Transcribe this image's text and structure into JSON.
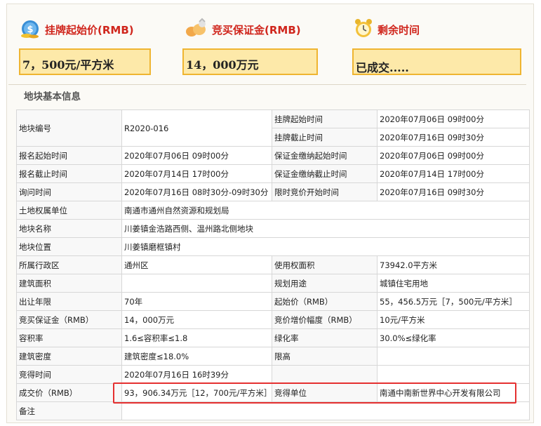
{
  "headers": {
    "start_price": "挂牌起始价(RMB)",
    "deposit": "竞买保证金(RMB)",
    "remaining_time": "剩余时间"
  },
  "values": {
    "start_price": "7，500元/平方米",
    "deposit": "14，000万元",
    "remaining_time": "已成交....."
  },
  "section_title": "地块基本信息",
  "info": {
    "parcel_no_label": "地块编号",
    "parcel_no": "R2020-016",
    "listing_start_label": "挂牌起始时间",
    "listing_start": "2020年07月06日 09时00分",
    "listing_end_label": "挂牌截止时间",
    "listing_end": "2020年07月16日 09时30分",
    "reg_start_label": "报名起始时间",
    "reg_start": "2020年07月06日 09时00分",
    "deposit_start_label": "保证金缴纳起始时间",
    "deposit_start": "2020年07月06日 09时00分",
    "reg_end_label": "报名截止时间",
    "reg_end": "2020年07月14日 17时00分",
    "deposit_end_label": "保证金缴纳截止时间",
    "deposit_end": "2020年07月14日 17时00分",
    "inquiry_label": "询问时间",
    "inquiry": "2020年07月16日 08时30分-09时30分",
    "timed_bid_label": "限时竞价开始时间",
    "timed_bid": "2020年07月16日 09时30分",
    "owner_label": "土地权属单位",
    "owner": "南通市通州自然资源和规划局",
    "name_label": "地块名称",
    "name": "川姜镇金浩路西侧、温州路北侧地块",
    "location_label": "地块位置",
    "location": "川姜镇磨框镇村",
    "district_label": "所属行政区",
    "district": "通州区",
    "use_area_label": "使用权面积",
    "use_area": "73942.0平方米",
    "build_area_label": "建筑面积",
    "build_area": "",
    "planned_use_label": "规划用途",
    "planned_use": "城镇住宅用地",
    "term_label": "出让年限",
    "term": "70年",
    "start_price_label": "起始价（RMB）",
    "start_price": "55，456.5万元［7，500元/平方米］",
    "deposit_label": "竞买保证金（RMB）",
    "deposit": "14，000万元",
    "increment_label": "竞价增价幅度（RMB）",
    "increment": "10元/平方米",
    "far_label": "容积率",
    "far": "1.6≤容积率≤1.8",
    "green_label": "绿化率",
    "green": "30.0%≤绿化率",
    "density_label": "建筑密度",
    "density": "建筑密度≤18.0%",
    "height_label": "限高",
    "height": "",
    "won_time_label": "竞得时间",
    "won_time": "2020年07月16日 16时39分",
    "deal_price_label": "成交价（RMB）",
    "deal_price": "93，906.34万元［12，700元/平方米］",
    "winner_label": "竞得单位",
    "winner": "南通中南新世界中心开发有限公司",
    "remarks_label": "备注",
    "remarks": ""
  }
}
